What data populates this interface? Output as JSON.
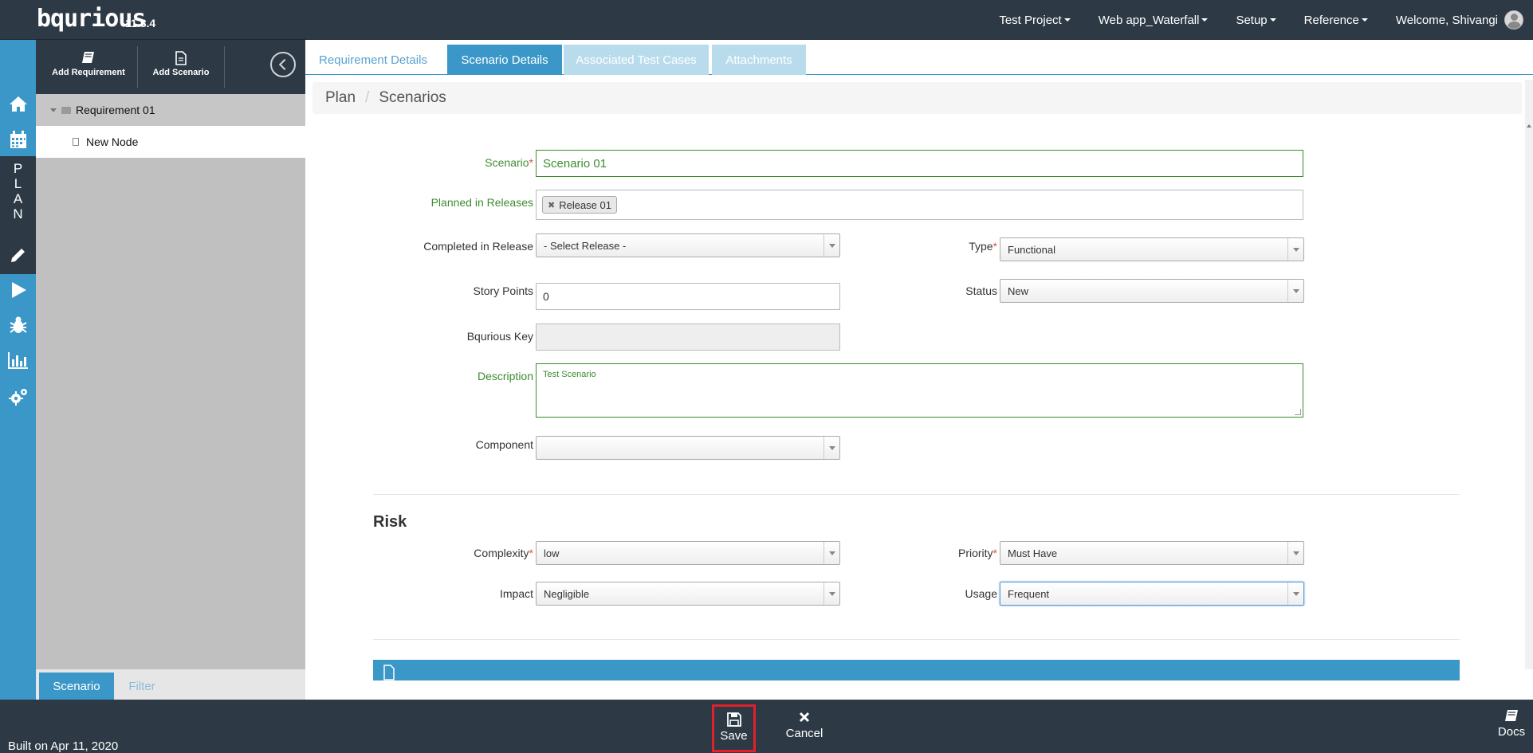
{
  "app": {
    "logo": "bqurious",
    "version": "11.8.4"
  },
  "topnav": {
    "project": "Test Project",
    "app": "Web app_Waterfall",
    "setup": "Setup",
    "reference": "Reference",
    "welcome": "Welcome, Shivangi"
  },
  "rail": {
    "plan_text": "P L A N"
  },
  "tree_toolbar": {
    "add_requirement": "Add Requirement",
    "add_scenario": "Add Scenario"
  },
  "tree": {
    "items": [
      {
        "label": "Requirement 01"
      },
      {
        "label": "New Node"
      }
    ]
  },
  "tree_tabs": {
    "scenario": "Scenario",
    "filter": "Filter"
  },
  "tabs": [
    {
      "label": "Requirement Details"
    },
    {
      "label": "Scenario Details"
    },
    {
      "label": "Associated Test Cases"
    },
    {
      "label": "Attachments"
    }
  ],
  "breadcrumb": {
    "root": "Plan",
    "separator": "/",
    "current": "Scenarios"
  },
  "form": {
    "scenario_label": "Scenario",
    "scenario_value": "Scenario 01",
    "planned_label": "Planned in Releases",
    "planned_tag": "Release 01",
    "completed_label": "Completed in Release",
    "completed_value": "- Select Release -",
    "type_label": "Type",
    "type_value": "Functional",
    "story_points_label": "Story Points",
    "story_points_value": "0",
    "status_label": "Status",
    "status_value": "New",
    "key_label": "Bqurious Key",
    "key_value": "",
    "description_label": "Description",
    "description_value": "Test Scenario",
    "component_label": "Component",
    "component_value": ""
  },
  "risk": {
    "title": "Risk",
    "complexity_label": "Complexity",
    "complexity_value": "low",
    "priority_label": "Priority",
    "priority_value": "Must Have",
    "impact_label": "Impact",
    "impact_value": "Negligible",
    "usage_label": "Usage",
    "usage_value": "Frequent"
  },
  "footer": {
    "built": "Built on Apr 11, 2020",
    "save": "Save",
    "cancel": "Cancel",
    "docs": "Docs"
  },
  "colors": {
    "accent": "#3a97c7",
    "dark": "#2d3a45",
    "required": "#d9534f",
    "valid": "#3c8d2f"
  }
}
